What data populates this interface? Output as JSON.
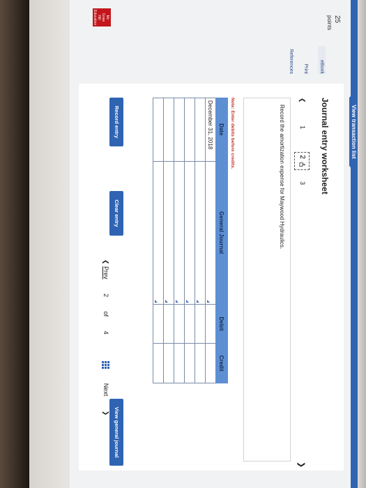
{
  "app": {
    "view_transaction_list": "View transaction list"
  },
  "sidebar": {
    "points_number": "25",
    "points_label": "points",
    "links": [
      "eBook",
      "Print",
      "References"
    ]
  },
  "worksheet": {
    "title": "Journal entry worksheet",
    "steps": [
      "1",
      "2",
      "3"
    ],
    "current_step": "2",
    "instruction": "Record the amortization expense for Maywood Hydraulics.",
    "note": "Note: Enter debits before credits."
  },
  "table": {
    "headers": [
      "Date",
      "General Journal",
      "Debit",
      "Credit"
    ],
    "rows": [
      {
        "date": "December 31, 2018",
        "account": "",
        "debit": "",
        "credit": ""
      },
      {
        "date": "",
        "account": "",
        "debit": "",
        "credit": ""
      },
      {
        "date": "",
        "account": "",
        "debit": "",
        "credit": ""
      },
      {
        "date": "",
        "account": "",
        "debit": "",
        "credit": ""
      },
      {
        "date": "",
        "account": "",
        "debit": "",
        "credit": ""
      },
      {
        "date": "",
        "account": "",
        "debit": "",
        "credit": ""
      }
    ]
  },
  "buttons": {
    "record_entry": "Record entry",
    "clear_entry": "Clear entry",
    "view_general_journal": "View general journal"
  },
  "footer": {
    "prev": "Prev",
    "page_current": "2",
    "page_of": "of",
    "page_total": "4",
    "next": "Next"
  },
  "logo": {
    "lines": [
      "Mc",
      "Graw",
      "Hill",
      "Education"
    ]
  }
}
